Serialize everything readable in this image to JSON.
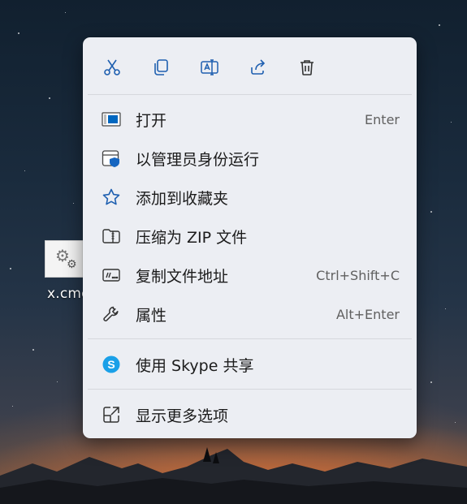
{
  "desktop": {
    "file_label": "x.cmd"
  },
  "toolbar": {
    "buttons": [
      {
        "name": "cut-button",
        "icon": "scissors-icon"
      },
      {
        "name": "copy-button",
        "icon": "copy-icon"
      },
      {
        "name": "rename-button",
        "icon": "rename-icon"
      },
      {
        "name": "share-button",
        "icon": "share-icon"
      },
      {
        "name": "delete-button",
        "icon": "trash-icon"
      }
    ]
  },
  "menu": {
    "items": [
      {
        "label": "打开",
        "shortcut": "Enter",
        "icon": "open-window-icon"
      },
      {
        "label": "以管理员身份运行",
        "shortcut": "",
        "icon": "admin-shield-icon"
      },
      {
        "label": "添加到收藏夹",
        "shortcut": "",
        "icon": "star-icon"
      },
      {
        "label": "压缩为 ZIP 文件",
        "shortcut": "",
        "icon": "zip-folder-icon"
      },
      {
        "label": "复制文件地址",
        "shortcut": "Ctrl+Shift+C",
        "icon": "copy-path-icon"
      },
      {
        "label": "属性",
        "shortcut": "Alt+Enter",
        "icon": "wrench-icon"
      },
      {
        "label": "使用 Skype 共享",
        "shortcut": "",
        "icon": "skype-icon"
      },
      {
        "label": "显示更多选项",
        "shortcut": "",
        "icon": "more-options-icon"
      }
    ]
  },
  "colors": {
    "accent": "#0067c0",
    "menu_bg": "#eceef3",
    "skype": "#1aa0e8"
  }
}
